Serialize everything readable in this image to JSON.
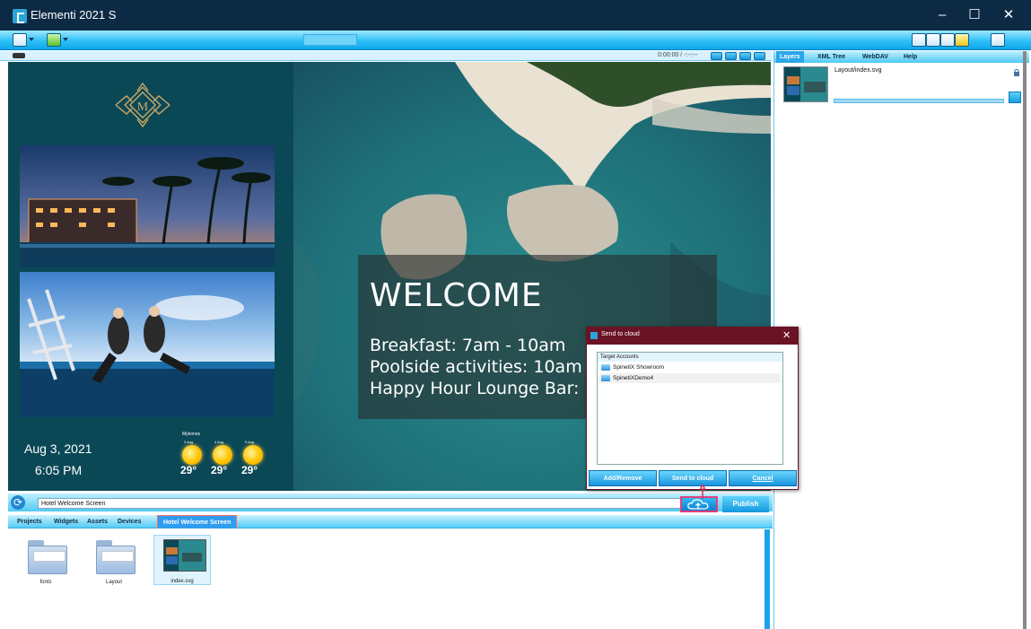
{
  "window": {
    "title": "Elementi 2021 S",
    "controls": {
      "minimize": "–",
      "maximize": "☐",
      "close": "✕"
    }
  },
  "player": {
    "time": "0:00:00 / -:--:--"
  },
  "preview": {
    "logo_letter": "M",
    "date": "Aug 3, 2021",
    "time": "6:05 PM",
    "weather": {
      "city": "Mykonos",
      "days": [
        {
          "label": "3 Aug",
          "temp": "29°"
        },
        {
          "label": "4 Aug",
          "temp": "29°"
        },
        {
          "label": "5 Aug",
          "temp": "29°"
        }
      ]
    },
    "welcome": {
      "title": "WELCOME",
      "lines": [
        "Breakfast: 7am - 10am",
        "Poolside activities: 10am",
        "Happy Hour Lounge Bar:"
      ]
    }
  },
  "project": {
    "name": "Hotel Welcome Screen",
    "publish_label": "Publish"
  },
  "tabs": [
    "Projects",
    "Widgets",
    "Assets",
    "Devices",
    "Hotel Welcome Screen"
  ],
  "assets": [
    {
      "label": "fonts",
      "type": "folder"
    },
    {
      "label": "Layout",
      "type": "folder"
    },
    {
      "label": "index.svg",
      "type": "thumbnail"
    }
  ],
  "right_panel": {
    "tabs": [
      "Layers",
      "XML Tree",
      "WebDAV",
      "Help"
    ],
    "layer_path": "Layout/index.svg"
  },
  "dialog": {
    "title": "Send to cloud",
    "list_header": "Target Accounts",
    "accounts": [
      "SpinetiX Showroom",
      "SpinetiXDemo4"
    ],
    "buttons": {
      "add_remove": "Add/Remove",
      "send": "Send to cloud",
      "cancel": "Cancel"
    }
  },
  "colors": {
    "title_bar": "#0d2a45",
    "toolbar_blue": "#2ec0f6",
    "dialog_title": "#6a1325",
    "preview_teal": "#0b4856"
  }
}
